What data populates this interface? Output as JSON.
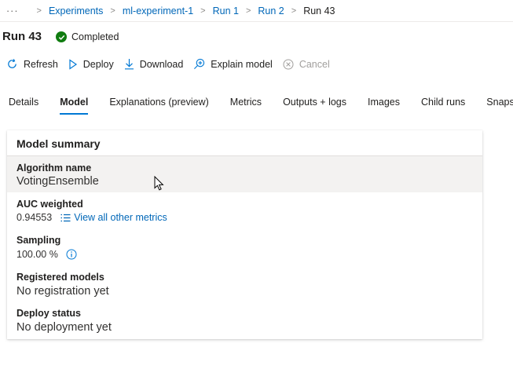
{
  "breadcrumb": {
    "more": "···",
    "items": [
      "Experiments",
      "ml-experiment-1",
      "Run 1",
      "Run 2"
    ],
    "current": "Run 43"
  },
  "run": {
    "title": "Run 43",
    "status": "Completed"
  },
  "toolbar": {
    "refresh": "Refresh",
    "deploy": "Deploy",
    "download": "Download",
    "explain": "Explain model",
    "cancel": "Cancel"
  },
  "tabs": [
    {
      "label": "Details"
    },
    {
      "label": "Model",
      "active": true
    },
    {
      "label": "Explanations (preview)"
    },
    {
      "label": "Metrics"
    },
    {
      "label": "Outputs + logs"
    },
    {
      "label": "Images"
    },
    {
      "label": "Child runs"
    },
    {
      "label": "Snapsho"
    }
  ],
  "summary": {
    "title": "Model summary",
    "algorithm_label": "Algorithm name",
    "algorithm_value": "VotingEnsemble",
    "auc_label": "AUC weighted",
    "auc_value": "0.94553",
    "auc_link": "View all other metrics",
    "sampling_label": "Sampling",
    "sampling_value": "100.00 %",
    "registered_label": "Registered models",
    "registered_value": "No registration yet",
    "deploy_label": "Deploy status",
    "deploy_value": "No deployment yet"
  },
  "colors": {
    "accent": "#0078d4",
    "link": "#0067b8",
    "success": "#107c10"
  }
}
